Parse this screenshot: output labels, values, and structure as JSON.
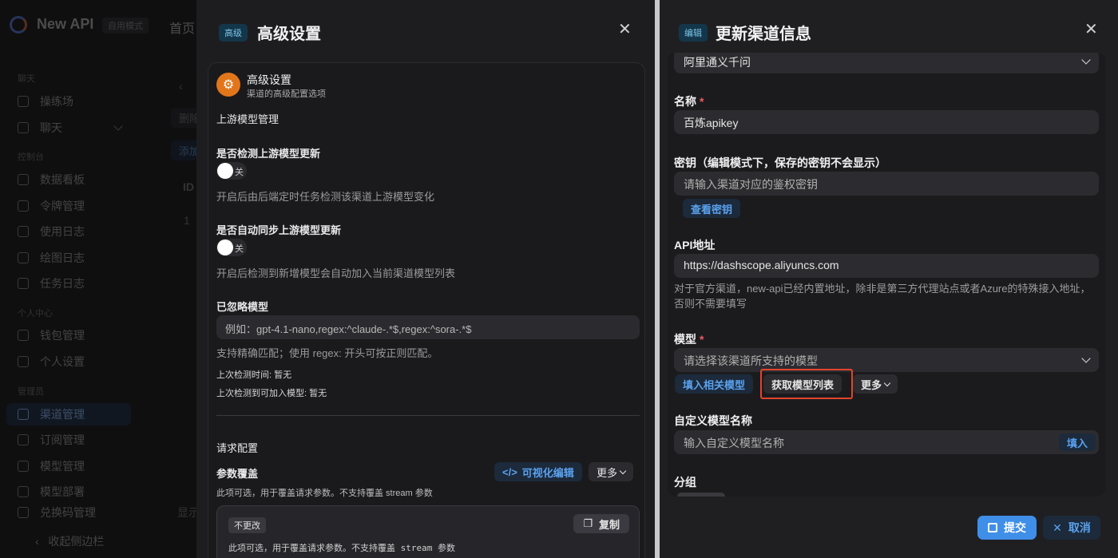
{
  "background_app": {
    "title": "New API",
    "mode": "自用模式",
    "nav_home": "首页",
    "sidebar": {
      "sections": [
        "聊天",
        "控制台",
        "个人中心",
        "管理员"
      ],
      "items": [
        "操练场",
        "聊天",
        "数据看板",
        "令牌管理",
        "使用日志",
        "绘图日志",
        "任务日志",
        "钱包管理",
        "个人设置",
        "渠道管理",
        "订阅管理",
        "模型管理",
        "模型部署",
        "兑换码管理"
      ],
      "active": "渠道管理",
      "collapse": "收起侧边栏"
    },
    "bits": {
      "delete": "删除",
      "add": "添加",
      "id": "ID",
      "row1": "1",
      "show": "显示"
    }
  },
  "advanced_modal": {
    "badge": "高级",
    "title": "高级设置",
    "card_title": "高级设置",
    "card_subtitle": "渠道的高级配置选项",
    "section_upstream": "上游模型管理",
    "detect_label": "是否检测上游模型更新",
    "detect_toggle": "关",
    "detect_help": "开启后由后端定时任务检测该渠道上游模型变化",
    "sync_label": "是否自动同步上游模型更新",
    "sync_toggle": "关",
    "sync_help": "开启后检测到新增模型会自动加入当前渠道模型列表",
    "ignored_label": "已忽略模型",
    "ignored_placeholder": "例如：gpt-4.1-nano,regex:^claude-.*$,regex:^sora-.*$",
    "ignored_help": "支持精确匹配；使用 regex: 开头可按正则匹配。",
    "last_check": "上次检测时间: 暂无",
    "last_check_models": "上次检测到可加入模型: 暂无",
    "section_request": "请求配置",
    "override_label": "参数覆盖",
    "visual_edit": "可视化编辑",
    "more": "更多",
    "override_help": "此项可选，用于覆盖请求参数。不支持覆盖 stream 参数",
    "no_change_tag": "不更改",
    "copy": "复制",
    "code_text": "此项可选，用于覆盖请求参数。不支持覆盖 stream 参数"
  },
  "channel_modal": {
    "badge": "编辑",
    "title": "更新渠道信息",
    "type_value": "阿里通义千问",
    "name_label": "名称",
    "name_value": "百炼apikey",
    "key_label": "密钥（编辑模式下，保存的密钥不会显示）",
    "key_placeholder": "请输入渠道对应的鉴权密钥",
    "view_key": "查看密钥",
    "api_label": "API地址",
    "api_value": "https://dashscope.aliyuncs.com",
    "api_help": "对于官方渠道，new-api已经内置地址，除非是第三方代理站点或者Azure的特殊接入地址，否则不需要填写",
    "model_label": "模型",
    "model_placeholder": "请选择该渠道所支持的模型",
    "fill_related": "填入相关模型",
    "fetch_models": "获取模型列表",
    "more": "更多",
    "custom_label": "自定义模型名称",
    "custom_placeholder": "输入自定义模型名称",
    "fill": "填入",
    "group_label": "分组",
    "submit": "提交",
    "cancel": "取消",
    "highlight_color": "#e4432f",
    "accent": "#3f8ee8"
  }
}
